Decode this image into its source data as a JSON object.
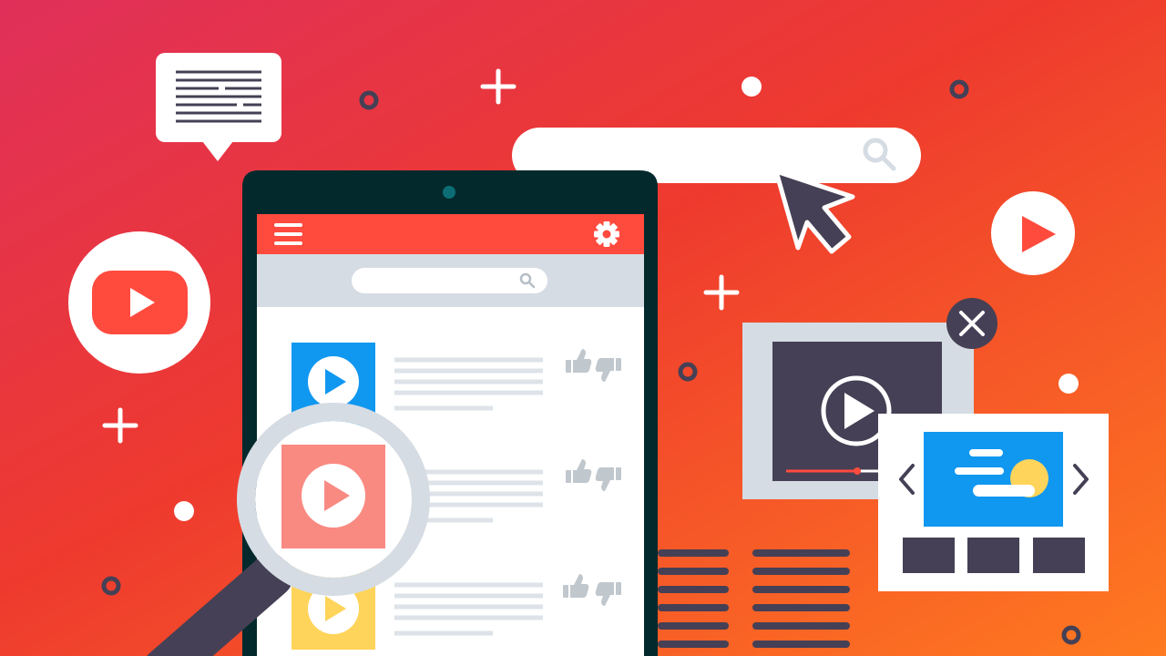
{
  "colors": {
    "bg_start": "#e0305a",
    "bg_mid": "#ee3a2e",
    "bg_end": "#ff7a20",
    "tablet_frame": "#04292c",
    "phone_header": "#ff4a3e",
    "search_strip": "#d5dce3",
    "thumb_blue": "#1097f0",
    "thumb_red": "#f98a82",
    "thumb_yellow": "#ffd45a",
    "text_lines": "#dde3e8",
    "thumb_icons": "#c0c7cd",
    "dark": "#454055",
    "white": "#ffffff"
  },
  "icons": [
    "speech-bubble-icon",
    "youtube-logo-icon",
    "hamburger-menu-icon",
    "gear-icon",
    "search-icon",
    "mouse-cursor-icon",
    "play-button-icon",
    "close-icon",
    "chevron-left-icon",
    "chevron-right-icon",
    "sun-icon",
    "magnifying-glass-icon",
    "thumbs-up-icon",
    "thumbs-down-icon"
  ],
  "video_list": [
    {
      "thumbnail": "blue"
    },
    {
      "thumbnail": "red"
    },
    {
      "thumbnail": "yellow"
    }
  ]
}
